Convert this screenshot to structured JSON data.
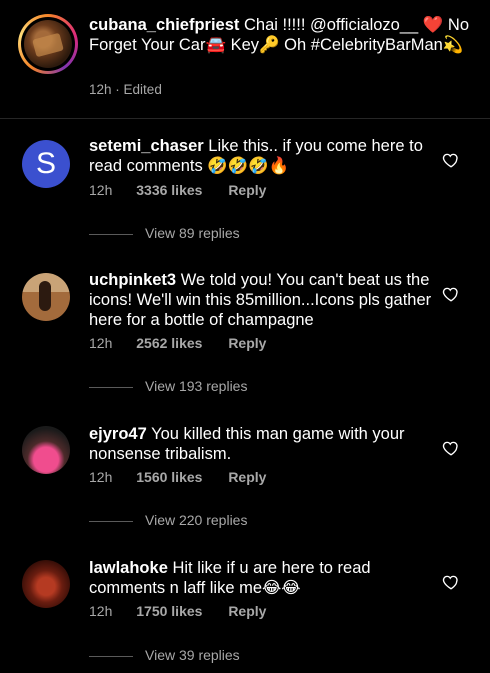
{
  "post": {
    "username": "cubana_chiefpriest",
    "caption": "Chai !!!!! @officialozo__ ❤️ No Forget Your Car🚘 Key🔑 Oh #CelebrityBarMan💫",
    "time": "12h",
    "edited": "· Edited"
  },
  "comments": [
    {
      "username": "setemi_chaser",
      "avatar_letter": "S",
      "text": "Like this.. if you come here to read comments 🤣🤣🤣🔥",
      "time": "12h",
      "likes": "3336 likes",
      "reply": "Reply",
      "view_replies": "View 89 replies"
    },
    {
      "username": "uchpinket3",
      "text": "We told you! You can't beat us the icons! We'll win this 85million...Icons pls gather here for a bottle of champagne",
      "time": "12h",
      "likes": "2562 likes",
      "reply": "Reply",
      "view_replies": "View 193 replies"
    },
    {
      "username": "ejyro47",
      "text": "You killed this man game with your nonsense tribalism.",
      "time": "12h",
      "likes": "1560 likes",
      "reply": "Reply",
      "view_replies": "View 220 replies"
    },
    {
      "username": "lawlahoke",
      "text": "Hit like if u are here to read comments n laff like me😂😂",
      "time": "12h",
      "likes": "1750 likes",
      "reply": "Reply",
      "view_replies": "View 39 replies"
    }
  ],
  "icons": {
    "like": "heart-outline-icon"
  },
  "colors": {
    "background": "#000000",
    "text": "#ffffff",
    "meta": "#a8a8a8",
    "avatar_s": "#3b50cf"
  }
}
